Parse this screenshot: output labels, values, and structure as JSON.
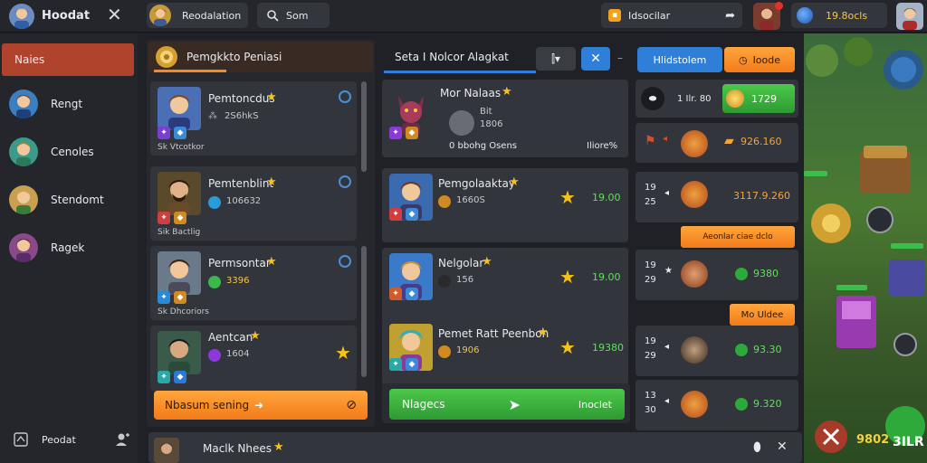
{
  "topbar": {
    "app_name": "Hoodat",
    "profile_name": "Reodalation",
    "search_text": "Som",
    "notice_text": "Idsocilar",
    "currency_value": "19.8ocls"
  },
  "sidebar": {
    "active_item": "Naies",
    "items": [
      "Rengt",
      "Cenoles",
      "Stendomt",
      "Ragek"
    ],
    "footer_label": "Peodat"
  },
  "left_panel": {
    "title": "Pemgkkto Peniasi",
    "cards": [
      {
        "name": "Pemtoncdus",
        "stat": "2S6hkS",
        "footer": "Sk Vtcotkor"
      },
      {
        "name": "Pemtenblint",
        "stat": "106632",
        "footer": "Sik Bactlig"
      },
      {
        "name": "Permsontar",
        "stat": "3396",
        "footer": "Sk Dhcoriors"
      },
      {
        "name": "Aentcan",
        "stat": "1604"
      }
    ],
    "action_button": "Nbasum sening",
    "bottom_card_name": "Maclk Nhees"
  },
  "middle_panel": {
    "title": "Seta I Nolcor Alagkat",
    "featured": {
      "name": "Mor Nalaas",
      "sub": "Bit",
      "stat": "1806",
      "footer_left": "0 bbohg Osens",
      "footer_right": "Iliore%"
    },
    "rows": [
      {
        "name": "Pemgolaaktay",
        "stat": "1660S",
        "value": "19.00"
      },
      {
        "name": "Nelgolar",
        "stat": "156",
        "value": "19.00"
      },
      {
        "name": "Pemet Ratt Peenbon",
        "stat": "1906",
        "value": "19380"
      }
    ],
    "action_button": "Nlagecs",
    "action_right": "Inoclet"
  },
  "right_panel": {
    "tab_primary": "Hlidstolem",
    "tab_secondary": "Ioode",
    "top_row": {
      "left": "1 Ilr. 80",
      "value": "1729"
    },
    "rows": [
      {
        "value": "926.160"
      },
      {
        "top": "19",
        "bottom": "25",
        "value": "3117.9.260"
      },
      {
        "top": "19",
        "bottom": "29",
        "value": "9380"
      },
      {
        "top": "19",
        "bottom": "29",
        "value": "93.30"
      },
      {
        "top": "13",
        "bottom": "30",
        "value": "9.320"
      }
    ],
    "banner_1": "Aeonlar ciae dclo",
    "banner_2": "Mo Uldee"
  },
  "game_view": {
    "label_1": "9802",
    "label_2": "3ILR"
  },
  "colors": {
    "accent_orange": "#f58a22",
    "accent_blue": "#2f7fd8",
    "accent_green": "#3fb441",
    "value_green": "#5fe05a",
    "value_orange": "#f3a33a"
  }
}
